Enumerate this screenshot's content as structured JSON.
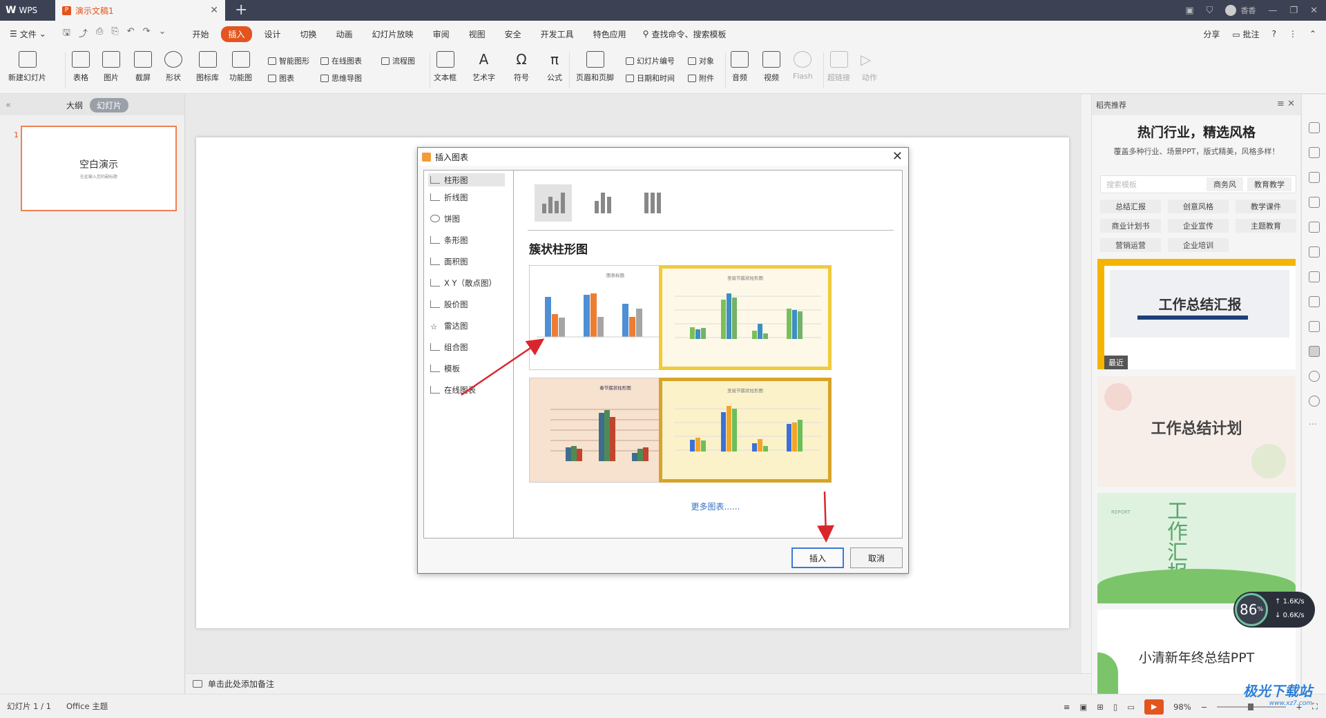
{
  "titlebar": {
    "app_tab": "WPS",
    "doc_tab": "演示文稿1",
    "doc_badge": "P",
    "user": "香香"
  },
  "menu": {
    "file": "文件",
    "tabs": [
      "开始",
      "插入",
      "设计",
      "切换",
      "动画",
      "幻灯片放映",
      "审阅",
      "视图",
      "安全",
      "开发工具",
      "特色应用"
    ],
    "active_tab": "插入",
    "search": "查找命令、搜索模板",
    "share": "分享",
    "comment": "批注",
    "help": "?"
  },
  "ribbon": {
    "new_slide": "新建幻灯片",
    "table": "表格",
    "picture": "图片",
    "screenshot": "截屏",
    "shape": "形状",
    "icon_lib": "图标库",
    "func_chart": "功能图",
    "smart_shape": "智能图形",
    "online_chart": "在线图表",
    "flowchart": "流程图",
    "chart": "图表",
    "mindmap": "思维导图",
    "textbox": "文本框",
    "wordart": "艺术字",
    "symbol": "符号",
    "formula": "公式",
    "header_footer": "页眉和页脚",
    "slide_number": "幻灯片编号",
    "object": "对象",
    "datetime": "日期和时间",
    "attachment": "附件",
    "audio": "音频",
    "video": "视频",
    "flash": "Flash",
    "hyperlink": "超链接",
    "action": "动作"
  },
  "leftpane": {
    "tabs": [
      "大纲",
      "幻灯片"
    ],
    "active_tab": "幻灯片",
    "slide_number": "1",
    "thumb_title": "空白演示",
    "thumb_subtitle": "在此输入您的副标题"
  },
  "notes_placeholder": "单击此处添加备注",
  "dialog": {
    "title": "插入图表",
    "categories": [
      "柱形图",
      "折线图",
      "饼图",
      "条形图",
      "面积图",
      "X Y（散点图）",
      "股价图",
      "雷达图",
      "组合图",
      "模板",
      "在线图表"
    ],
    "active_category": "柱形图",
    "section_title": "簇状柱形图",
    "thumbs": [
      {
        "title": "图表标题"
      },
      {
        "title": "圣诞节簇状柱形图"
      },
      {
        "title": "春节簇状柱形图"
      },
      {
        "title": "圣诞节簇状柱形图"
      }
    ],
    "more_link": "更多图表......",
    "insert_button": "插入",
    "cancel_button": "取消"
  },
  "rightpane": {
    "header": "稻壳推荐",
    "title": "热门行业，精选风格",
    "subtitle": "覆盖多种行业、场景PPT，版式精美，风格多样！",
    "search_placeholder": "搜索模板",
    "search_chips": [
      "商务风",
      "教育教学"
    ],
    "tags": [
      "总结汇报",
      "创意风格",
      "教学课件",
      "商业计划书",
      "企业宣传",
      "主题教育",
      "营销运营",
      "企业培训"
    ],
    "templates": [
      {
        "title": "工作总结汇报",
        "badge": "最近"
      },
      {
        "title": "工作总结计划"
      },
      {
        "title": "工作汇报",
        "sub": "REPORT"
      },
      {
        "title": "小清新年终总结PPT"
      }
    ]
  },
  "speed_widget": {
    "percent": "86",
    "up": "1.6K/s",
    "down": "0.6K/s"
  },
  "statusbar": {
    "slide_info": "幻灯片 1 / 1",
    "theme": "Office 主题",
    "zoom": "98%"
  },
  "watermark": {
    "text": "极光下载站",
    "url": "www.xz7.com"
  },
  "colors": {
    "accent": "#e3541f",
    "titlebar": "#3c4254",
    "arrow": "#d9262c",
    "link": "#3573c5"
  }
}
